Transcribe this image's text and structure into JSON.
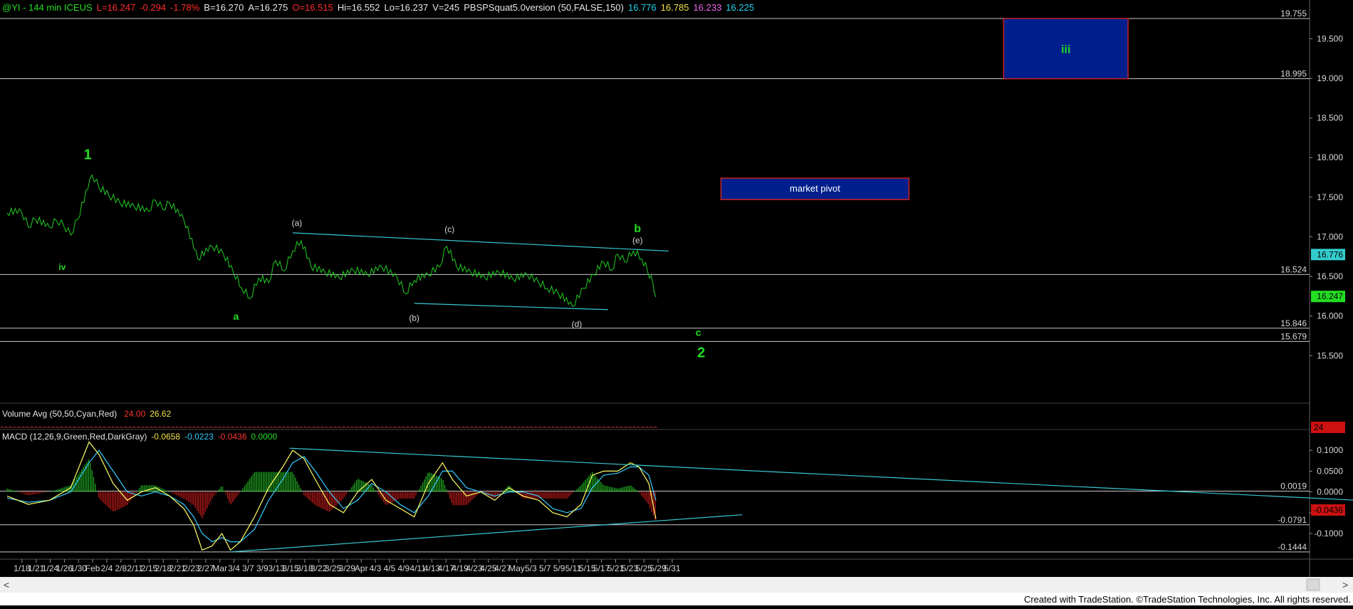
{
  "header": {
    "parts": [
      {
        "text": "@YI - 144 min  ICEUS",
        "color": "#22dd22"
      },
      {
        "text": "L=16.247",
        "color": "#ff2b2b"
      },
      {
        "text": "-0.294",
        "color": "#ff2b2b"
      },
      {
        "text": "-1.78%",
        "color": "#ff2b2b"
      },
      {
        "text": "B=16.270",
        "color": "#e6e6e6"
      },
      {
        "text": "A=16.275",
        "color": "#e6e6e6"
      },
      {
        "text": "O=16.515",
        "color": "#ff2b2b"
      },
      {
        "text": "Hi=16.552",
        "color": "#e6e6e6"
      },
      {
        "text": "Lo=16.237",
        "color": "#e6e6e6"
      },
      {
        "text": "V=245",
        "color": "#e6e6e6"
      },
      {
        "text": "PBSPSquat5.0version (50,FALSE,150)",
        "color": "#e6e6e6"
      },
      {
        "text": "16.776",
        "color": "#22d3ee"
      },
      {
        "text": "16.785",
        "color": "#f2e14a"
      },
      {
        "text": "16.233",
        "color": "#ee66ee"
      },
      {
        "text": "16.225",
        "color": "#22d3ee"
      }
    ]
  },
  "colors": {
    "background": "#000000",
    "price": "#22cc22",
    "trendline": "#38c8d0",
    "hline": "#c8c8c8",
    "box_fill": "#001f8c",
    "box_border": "#cc2222",
    "wave_green": "#22dd22",
    "wave_white": "#d8d8d8",
    "macd_line": "#ffff66",
    "macd_signal": "#33ccff",
    "hist_pos": "#1e9e1e",
    "hist_neg": "#b01818",
    "vol": "#b03030"
  },
  "chart_data": [
    {
      "type": "line",
      "name": "price",
      "x_tick_labels": [
        "1/18",
        "1/21",
        "1/24",
        "1/26",
        "1/30",
        "Feb",
        "2/4",
        "2/8",
        "2/11",
        "2/15",
        "2/18",
        "2/21",
        "2/23",
        "2/27",
        "Mar",
        "3/4",
        "3/7",
        "3/9",
        "3/13",
        "3/15",
        "3/18",
        "3/22",
        "3/25",
        "3/29",
        "Apr",
        "4/3",
        "4/5",
        "4/9",
        "4/11",
        "4/13",
        "4/17",
        "4/19",
        "4/23",
        "4/25",
        "4/27",
        "May",
        "5/3",
        "5/7",
        "5/9",
        "5/11",
        "5/15",
        "5/17",
        "5/21",
        "5/23",
        "5/25",
        "5/29",
        "5/31"
      ],
      "y_ticks": [
        15.5,
        16.0,
        16.5,
        17.0,
        17.5,
        18.0,
        18.5,
        19.0,
        19.5
      ],
      "y_tick_labels": [
        "15.500",
        "16.000",
        "16.500",
        "17.000",
        "17.500",
        "18.000",
        "18.500",
        "19.000",
        "19.500"
      ],
      "ylim": [
        14.9,
        19.8
      ],
      "points": [
        [
          0,
          17.3
        ],
        [
          1.0,
          17.32
        ],
        [
          1.5,
          17.12
        ],
        [
          2.0,
          17.22
        ],
        [
          3.0,
          17.12
        ],
        [
          3.5,
          17.2
        ],
        [
          4.0,
          17.14
        ],
        [
          4.5,
          17.02
        ],
        [
          5.0,
          17.22
        ],
        [
          6.0,
          17.78
        ],
        [
          6.5,
          17.62
        ],
        [
          7.2,
          17.52
        ],
        [
          8.0,
          17.42
        ],
        [
          9.0,
          17.38
        ],
        [
          10.0,
          17.32
        ],
        [
          10.5,
          17.46
        ],
        [
          11.0,
          17.35
        ],
        [
          11.5,
          17.42
        ],
        [
          12.5,
          17.22
        ],
        [
          13.5,
          16.72
        ],
        [
          14.5,
          16.88
        ],
        [
          15.3,
          16.78
        ],
        [
          16.0,
          16.55
        ],
        [
          16.6,
          16.35
        ],
        [
          17.2,
          16.22
        ],
        [
          17.8,
          16.48
        ],
        [
          18.5,
          16.42
        ],
        [
          19.0,
          16.7
        ],
        [
          19.6,
          16.57
        ],
        [
          20.2,
          16.82
        ],
        [
          20.8,
          16.95
        ],
        [
          21.5,
          16.62
        ],
        [
          22.5,
          16.55
        ],
        [
          23.5,
          16.48
        ],
        [
          24.5,
          16.58
        ],
        [
          25.5,
          16.52
        ],
        [
          26.5,
          16.62
        ],
        [
          27.6,
          16.48
        ],
        [
          28.2,
          16.28
        ],
        [
          28.8,
          16.45
        ],
        [
          29.8,
          16.52
        ],
        [
          30.6,
          16.62
        ],
        [
          31.1,
          16.88
        ],
        [
          31.8,
          16.62
        ],
        [
          32.8,
          16.55
        ],
        [
          33.8,
          16.48
        ],
        [
          34.8,
          16.55
        ],
        [
          35.8,
          16.46
        ],
        [
          36.8,
          16.52
        ],
        [
          37.6,
          16.42
        ],
        [
          38.2,
          16.35
        ],
        [
          39.0,
          16.28
        ],
        [
          40.0,
          16.12
        ],
        [
          40.8,
          16.35
        ],
        [
          41.5,
          16.52
        ],
        [
          42.2,
          16.68
        ],
        [
          42.8,
          16.58
        ],
        [
          43.2,
          16.78
        ],
        [
          43.7,
          16.68
        ],
        [
          44.3,
          16.82
        ],
        [
          44.9,
          16.72
        ],
        [
          45.3,
          16.57
        ],
        [
          45.7,
          16.4
        ],
        [
          45.9,
          16.24
        ]
      ],
      "horizontal_lines": [
        {
          "value": 19.755,
          "label": "19.755"
        },
        {
          "value": 18.995,
          "label": "18.995"
        },
        {
          "value": 16.524,
          "label": "16.524"
        },
        {
          "value": 15.846,
          "label": "15.846"
        },
        {
          "value": 15.679,
          "label": "15.679"
        }
      ],
      "trendlines": [
        {
          "from": [
            20.2,
            17.05
          ],
          "to": [
            46.8,
            16.82
          ]
        },
        {
          "from": [
            28.8,
            16.16
          ],
          "to": [
            42.5,
            16.08
          ]
        }
      ],
      "boxes": [
        {
          "label": "iii",
          "x_from": 70.5,
          "x_to": 79.3,
          "y_from": 18.995,
          "y_to": 19.755
        },
        {
          "label": "market pivot",
          "x_from": 50.5,
          "x_to": 63.8,
          "y_from": 17.47,
          "y_to": 17.74
        }
      ],
      "wave_labels": [
        {
          "text": "1",
          "x": 5.7,
          "y": 17.98,
          "color": "green",
          "size": 20
        },
        {
          "text": "iv",
          "x": 3.9,
          "y": 16.58,
          "color": "green",
          "size": 12
        },
        {
          "text": "a",
          "x": 16.2,
          "y": 15.95,
          "color": "green",
          "size": 14
        },
        {
          "text": "(a)",
          "x": 20.5,
          "y": 17.14,
          "color": "white",
          "size": 12
        },
        {
          "text": "(b)",
          "x": 28.8,
          "y": 15.94,
          "color": "white",
          "size": 12
        },
        {
          "text": "(c)",
          "x": 31.3,
          "y": 17.06,
          "color": "white",
          "size": 12
        },
        {
          "text": "(d)",
          "x": 40.3,
          "y": 15.86,
          "color": "white",
          "size": 12
        },
        {
          "text": "(e)",
          "x": 44.6,
          "y": 16.92,
          "color": "white",
          "size": 12
        },
        {
          "text": "b",
          "x": 44.6,
          "y": 17.06,
          "color": "green",
          "size": 16
        },
        {
          "text": "c",
          "x": 48.9,
          "y": 15.75,
          "color": "green",
          "size": 14
        },
        {
          "text": "2",
          "x": 49.1,
          "y": 15.48,
          "color": "green",
          "size": 20
        }
      ],
      "right_badges": [
        {
          "value": 16.776,
          "label": "16.776",
          "bg": "#33cccc",
          "fg": "#000000"
        },
        {
          "value": 16.247,
          "label": "16.247",
          "bg": "#22dd22",
          "fg": "#000000"
        }
      ]
    },
    {
      "type": "bar",
      "name": "Volume Avg",
      "title": "Volume Avg (50,50,Cyan,Red)",
      "values_text": [
        "24.00",
        "26.62"
      ],
      "badge": "24"
    },
    {
      "type": "line",
      "name": "MACD",
      "title": "MACD (12,26,9,Green,Red,DarkGray)",
      "values_text": [
        "-0.0658",
        "-0.0223",
        "-0.0436",
        "0.0000"
      ],
      "y_ticks": [
        -0.1,
        -0.05,
        0.0,
        0.05,
        0.1
      ],
      "y_tick_labels": [
        "-0.1000",
        "-0.0500",
        "0.0000",
        "0.0500",
        "0.1000"
      ],
      "ylim": [
        -0.16,
        0.15
      ],
      "horizontal_lines": [
        {
          "value": 0.0019,
          "label": "0.0019"
        },
        {
          "value": -0.0791,
          "label": "-0.0791"
        },
        {
          "value": -0.1444,
          "label": "-0.1444"
        }
      ],
      "macd": [
        [
          0,
          -0.01
        ],
        [
          1.5,
          -0.03
        ],
        [
          3.0,
          -0.02
        ],
        [
          4.5,
          0.01
        ],
        [
          5.8,
          0.12
        ],
        [
          6.5,
          0.09
        ],
        [
          7.5,
          0.02
        ],
        [
          8.5,
          -0.02
        ],
        [
          9.5,
          0.0
        ],
        [
          10.5,
          0.01
        ],
        [
          11.5,
          -0.01
        ],
        [
          12.5,
          -0.04
        ],
        [
          13.2,
          -0.08
        ],
        [
          13.8,
          -0.14
        ],
        [
          14.5,
          -0.13
        ],
        [
          15.2,
          -0.1
        ],
        [
          15.8,
          -0.14
        ],
        [
          16.5,
          -0.12
        ],
        [
          17.5,
          -0.06
        ],
        [
          18.5,
          0.01
        ],
        [
          19.5,
          0.06
        ],
        [
          20.2,
          0.1
        ],
        [
          21.0,
          0.08
        ],
        [
          21.8,
          0.03
        ],
        [
          22.8,
          -0.03
        ],
        [
          23.8,
          -0.05
        ],
        [
          24.8,
          0.0
        ],
        [
          25.8,
          0.03
        ],
        [
          26.8,
          -0.02
        ],
        [
          27.8,
          -0.04
        ],
        [
          28.8,
          -0.06
        ],
        [
          29.8,
          0.02
        ],
        [
          30.8,
          0.07
        ],
        [
          31.5,
          0.03
        ],
        [
          32.5,
          -0.01
        ],
        [
          33.5,
          0.0
        ],
        [
          34.5,
          -0.02
        ],
        [
          35.5,
          0.01
        ],
        [
          36.5,
          -0.01
        ],
        [
          37.6,
          -0.02
        ],
        [
          38.6,
          -0.05
        ],
        [
          39.6,
          -0.06
        ],
        [
          40.6,
          -0.03
        ],
        [
          41.4,
          0.04
        ],
        [
          42.2,
          0.05
        ],
        [
          43.2,
          0.05
        ],
        [
          44.1,
          0.07
        ],
        [
          44.7,
          0.06
        ],
        [
          45.4,
          0.02
        ],
        [
          45.9,
          -0.065
        ]
      ],
      "signal": [
        [
          0,
          -0.015
        ],
        [
          1.5,
          -0.025
        ],
        [
          3.0,
          -0.02
        ],
        [
          4.5,
          0.0
        ],
        [
          5.8,
          0.07
        ],
        [
          6.5,
          0.1
        ],
        [
          7.5,
          0.05
        ],
        [
          8.5,
          0.0
        ],
        [
          9.5,
          -0.01
        ],
        [
          10.5,
          0.0
        ],
        [
          11.5,
          -0.01
        ],
        [
          12.5,
          -0.03
        ],
        [
          13.2,
          -0.06
        ],
        [
          13.8,
          -0.1
        ],
        [
          14.5,
          -0.12
        ],
        [
          15.2,
          -0.11
        ],
        [
          15.8,
          -0.12
        ],
        [
          16.5,
          -0.12
        ],
        [
          17.5,
          -0.09
        ],
        [
          18.5,
          -0.02
        ],
        [
          19.5,
          0.03
        ],
        [
          20.2,
          0.07
        ],
        [
          21.0,
          0.085
        ],
        [
          21.8,
          0.05
        ],
        [
          22.8,
          0.0
        ],
        [
          23.8,
          -0.04
        ],
        [
          24.8,
          -0.02
        ],
        [
          25.8,
          0.02
        ],
        [
          26.8,
          0.0
        ],
        [
          27.8,
          -0.03
        ],
        [
          28.8,
          -0.05
        ],
        [
          29.8,
          -0.01
        ],
        [
          30.8,
          0.05
        ],
        [
          31.5,
          0.05
        ],
        [
          32.5,
          0.01
        ],
        [
          33.5,
          0.0
        ],
        [
          34.5,
          -0.01
        ],
        [
          35.5,
          0.0
        ],
        [
          36.5,
          0.0
        ],
        [
          37.6,
          -0.01
        ],
        [
          38.6,
          -0.04
        ],
        [
          39.6,
          -0.05
        ],
        [
          40.6,
          -0.04
        ],
        [
          41.4,
          0.01
        ],
        [
          42.2,
          0.04
        ],
        [
          43.2,
          0.045
        ],
        [
          44.1,
          0.06
        ],
        [
          44.7,
          0.06
        ],
        [
          45.4,
          0.04
        ],
        [
          45.9,
          -0.02
        ]
      ],
      "trendlines": [
        {
          "from": [
            20.0,
            0.105
          ],
          "to": [
            95.4,
            -0.02
          ]
        },
        {
          "from": [
            15.8,
            -0.1444
          ],
          "to": [
            52.0,
            -0.055
          ]
        }
      ]
    }
  ],
  "scrollbar": {
    "left_arrow": "<",
    "right_arrow": ">"
  },
  "footer": {
    "credit": "Created with TradeStation. ©TradeStation Technologies, Inc. All rights reserved."
  }
}
